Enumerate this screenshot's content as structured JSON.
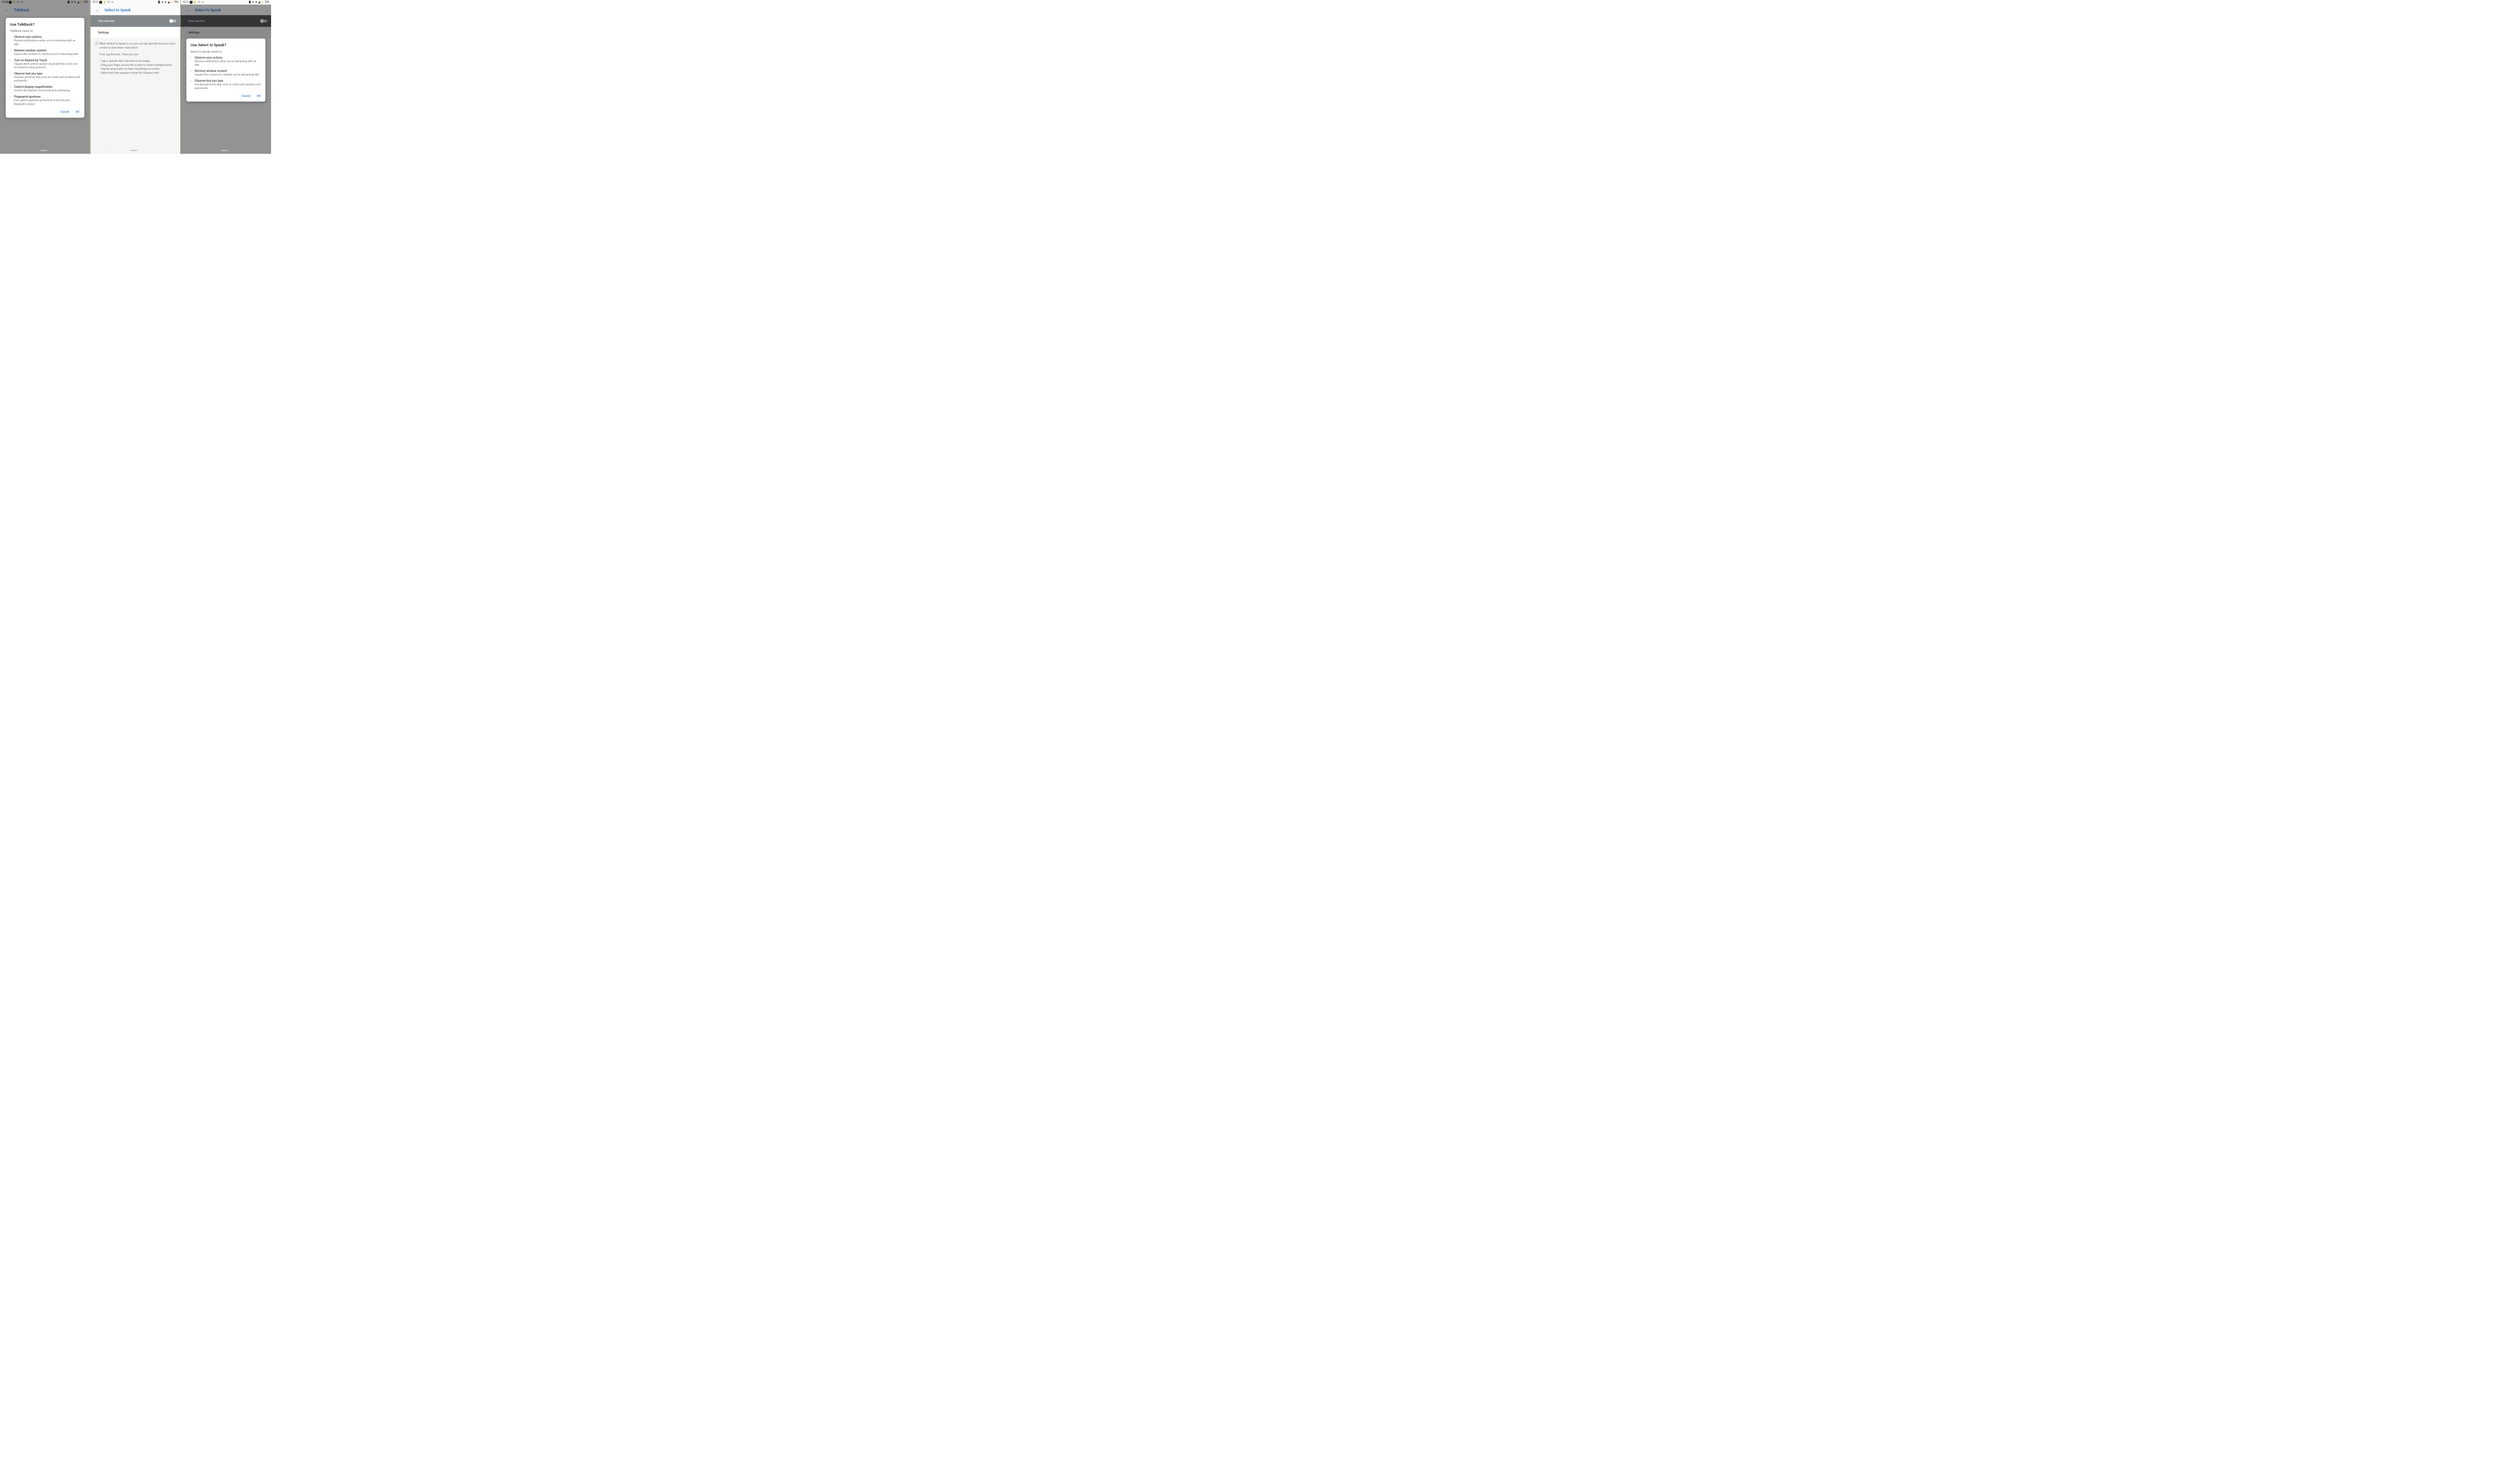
{
  "phone1": {
    "status": {
      "time": "12:08",
      "cal": "31",
      "battery": "70%"
    },
    "app_title": "TalkBack",
    "dialog": {
      "title": "Use TalkBack?",
      "subtitle": "TalkBack needs to:",
      "permissions": [
        {
          "title": "Observe your actions",
          "desc": "Receive notifications when you're interacting with an app."
        },
        {
          "title": "Retrieve window content",
          "desc": "Inspect the content of a window you're interacting with."
        },
        {
          "title": "Turn on Explore by Touch",
          "desc": "Tapped items will be spoken aloud and the screen can be explored using gestures."
        },
        {
          "title": "Observe text you type",
          "desc": "Includes personal data such as credit card numbers and passwords."
        },
        {
          "title": "Control display magnification",
          "desc": "Control the display's zoom level and positioning."
        },
        {
          "title": "Fingerprint gestures",
          "desc": "Can capture gestures performed on the device's fingerprint sensor."
        }
      ],
      "cancel": "Cancel",
      "ok": "OK"
    }
  },
  "phone2": {
    "status": {
      "time": "12:11",
      "cal": "31",
      "battery": "72%"
    },
    "app_title": "Select to Speak",
    "use_service_label": "Use service",
    "settings_label": "Settings",
    "info": {
      "p1": "When Select to Speak is on, you can tap specific items on your screen to hear them read aloud.",
      "p2": "First, tap the icon. Then you can:",
      "bullets": [
        "Tap a specific item, like text or an image",
        "Drag your finger across the screen to select multiple items",
        "Tap the play button to hear everything on screen",
        "Select text that appears inside the Camera view"
      ]
    }
  },
  "phone3": {
    "status": {
      "time": "12:11",
      "cal": "31",
      "battery": "73%"
    },
    "app_title": "Select to Speak",
    "use_service_label": "Use service",
    "settings_label": "Settings",
    "dialog": {
      "title": "Use Select to Speak?",
      "subtitle": "Select to Speak needs to:",
      "permissions": [
        {
          "title": "Observe your actions",
          "desc": "Receive notifications when you're interacting with an app."
        },
        {
          "title": "Retrieve window content",
          "desc": "Inspect the content of a window you're interacting with."
        },
        {
          "title": "Observe text you type",
          "desc": "Includes personal data such as credit card numbers and passwords."
        }
      ],
      "cancel": "Cancel",
      "ok": "OK"
    }
  }
}
